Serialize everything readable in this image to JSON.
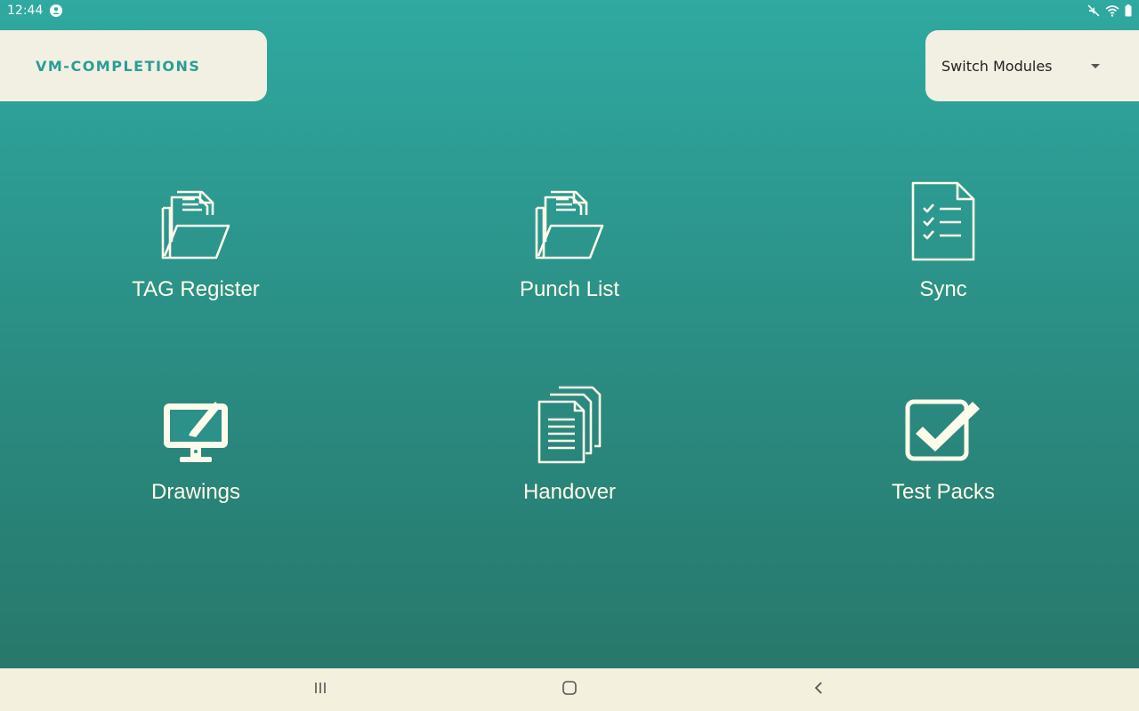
{
  "status": {
    "time": "12:44"
  },
  "brand": {
    "name": "VM-COMPLETIONS"
  },
  "module_switch": {
    "selected": "Switch Modules"
  },
  "tiles": [
    {
      "label": "TAG Register",
      "icon": "folder-documents-icon"
    },
    {
      "label": "Punch List",
      "icon": "folder-documents-icon"
    },
    {
      "label": "Sync",
      "icon": "checklist-icon"
    },
    {
      "label": "Drawings",
      "icon": "monitor-pen-icon"
    },
    {
      "label": "Handover",
      "icon": "stacked-documents-icon"
    },
    {
      "label": "Test Packs",
      "icon": "checkbox-icon"
    }
  ],
  "colors": {
    "gradient_top": "#2fa9a1",
    "gradient_bottom": "#277568",
    "card_bg": "#f2f0e3",
    "brand_text": "#2a9d96",
    "icon_color": "#fffbea"
  }
}
